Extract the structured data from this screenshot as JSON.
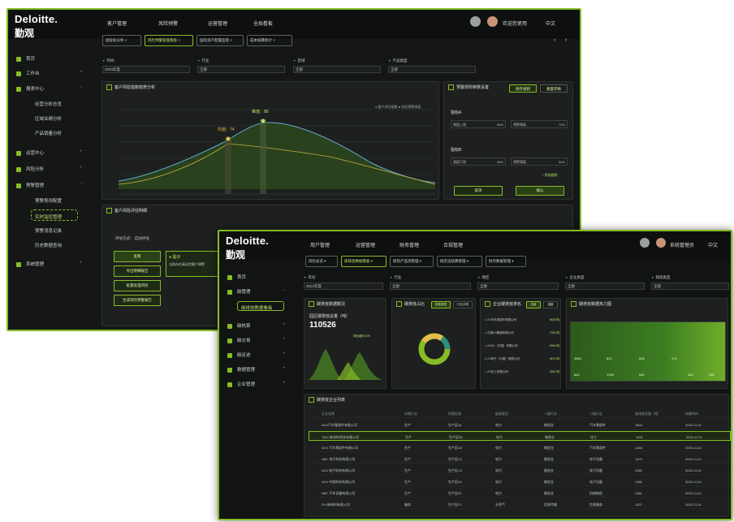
{
  "brand": {
    "name": "Deloitte.",
    "sub": "勤观"
  },
  "colors": {
    "accent": "#86bc25",
    "bg": "#141716"
  },
  "w1": {
    "nav": [
      "客户管理",
      "风险预警",
      "运营管理",
      "全局看板"
    ],
    "user": "欢迎您使用",
    "lang": "中文",
    "tabs": [
      "招投标分析 ×",
      "风险预警管理看板 ×",
      "国有资产配置监管 ×",
      "成本核算统计 ×"
    ],
    "side": [
      {
        "label": "首页",
        "icon": "home-icon"
      },
      {
        "label": "工作台",
        "icon": "grid-icon"
      },
      {
        "label": "报表中心",
        "icon": "report-icon"
      },
      {
        "label": "经营分析总览",
        "icon": ""
      },
      {
        "label": "区域业绩分析",
        "icon": ""
      },
      {
        "label": "产品销量分析",
        "icon": ""
      },
      {
        "label": "运营中心",
        "icon": "ops-icon"
      },
      {
        "label": "风险分析",
        "icon": "risk-icon"
      },
      {
        "label": "预警管理",
        "icon": "alert-icon"
      },
      {
        "label": "预警规则配置",
        "icon": ""
      },
      {
        "label": "实时监控管理",
        "icon": ""
      },
      {
        "label": "预警消息记录",
        "icon": ""
      },
      {
        "label": "历史数据查询",
        "icon": ""
      },
      {
        "label": "系统管理",
        "icon": "settings-icon"
      }
    ],
    "filters": [
      {
        "label": "时间",
        "value": "2023年度"
      },
      {
        "label": "行业",
        "value": "全部"
      },
      {
        "label": "区域",
        "value": "全部"
      },
      {
        "label": "产品类型",
        "value": "全部"
      }
    ],
    "chart_panel": {
      "title": "客户风险指数趋势分析",
      "legend": [
        "客户风险指数",
        "风险预警阈值"
      ],
      "peak1": "峰值：86",
      "peak2": "均值：74"
    },
    "side_panel": {
      "title": "预警规则参数设置",
      "btn1": "保存规则",
      "btn2": "重置参数",
      "sec1": "指标A",
      "sec2": "指标B",
      "in1": "阈值上限",
      "in1u": "85%",
      "in2": "预警阈值",
      "in2u": "70%",
      "in3": "阈值下限",
      "in3u": "35%",
      "in4": "预警阈值",
      "in4u": "50%",
      "add": "+ 添加规则",
      "cancel": "取消",
      "confirm": "确认"
    },
    "bottom_panel": {
      "title": "客户风险评估明细",
      "label": "评估方式：",
      "value": "自动评估",
      "b1": "查看",
      "b2": "导出明细报告",
      "b3": "批量处理风险",
      "b4": "生成风险预警报告",
      "alert": "● 提示",
      "alert_text": "当前存在高风险客户预警"
    }
  },
  "w2": {
    "nav": [
      "用户管理",
      "运营管理",
      "财务管理",
      "合规管理"
    ],
    "user": "系统管理员",
    "lang": "中文",
    "tabs": [
      "风险总览 ▾",
      "碳排放数据看板 ▾",
      "碳资产监测管理 ▾",
      "碳足迹核算管理 ▾",
      "财务数据管理 ▾"
    ],
    "side": [
      {
        "label": "首页",
        "icon": "home-icon"
      },
      {
        "label": "碳管理",
        "icon": "grid-icon"
      },
      {
        "label": "碳排放数据看板",
        "icon": ""
      },
      {
        "label": "碳核算",
        "icon": "calc-icon"
      },
      {
        "label": "碳交易",
        "icon": "trade-icon"
      },
      {
        "label": "碳足迹",
        "icon": "foot-icon"
      },
      {
        "label": "数据管理",
        "icon": "data-icon"
      },
      {
        "label": "企业管理",
        "icon": "company-icon"
      }
    ],
    "filters": [
      {
        "label": "年份",
        "value": "2023年度"
      },
      {
        "label": "行业",
        "value": "全部"
      },
      {
        "label": "地区",
        "value": "全部"
      },
      {
        "label": "企业类型",
        "value": "全部"
      },
      {
        "label": "排放类型",
        "value": "全部"
      }
    ],
    "kpi": {
      "title": "碳排放数据概况",
      "sub": "园区碳排放总量（吨）",
      "value": "110526",
      "peak_note": "同比增长12%"
    },
    "donut": {
      "title": "碳排放占比",
      "tab1": "排放类型",
      "tab2": "行业分类"
    },
    "ranking": {
      "title": "企业碳排放排名",
      "tab1": "总量",
      "tab2": "强度",
      "items": [
        {
          "name": "XX汽车零部件有限公司",
          "value": "9825 吨"
        },
        {
          "name": "中国XX集团有限公司",
          "value": "7350 吨"
        },
        {
          "name": "XXXX（中国）有限公司",
          "value": "5960 吨"
        },
        {
          "name": "XX电子（中国）有限公司",
          "value": "4870 吨"
        },
        {
          "name": "XX化工有限公司",
          "value": "4352 吨"
        }
      ]
    },
    "heat": {
      "title": "碳排放数据热力图",
      "vals": [
        "3884",
        "822",
        "858",
        "472",
        "882",
        "1256",
        "680",
        "340",
        "388"
      ]
    },
    "table": {
      "title": "碳排放企业列表",
      "cols": [
        "企业名称",
        "所属行业",
        "所属区域",
        "能源类型",
        "一级行业",
        "二级行业",
        "碳排放总量（吨）",
        "核算时间"
      ],
      "rows": [
        [
          "AXX汽车零部件有限公司",
          "生产",
          "生产区A1",
          "电力",
          "制造业",
          "汽车零部件",
          "1504",
          "2023.11.24"
        ],
        [
          "BXX 新材料科技有限公司",
          "生产",
          "生产区B2",
          "电力",
          "制造业",
          "化工",
          "1502",
          "2023.11.24"
        ],
        [
          "AXX 汽车零部件有限公司",
          "生产",
          "生产区A3",
          "电力",
          "制造业",
          "汽车零部件",
          "1466",
          "2023.11.24"
        ],
        [
          "ABC 电子科技有限公司",
          "生产",
          "生产区C1",
          "电力",
          "制造业",
          "电子设备",
          "1470",
          "2023.11.24"
        ],
        [
          "AXX 电子科技有限公司",
          "生产",
          "生产区C2",
          "电力",
          "制造业",
          "电子设备",
          "1350",
          "2023.11.24"
        ],
        [
          "AXX 中国科技有限公司",
          "生产",
          "生产区D1",
          "电力",
          "制造业",
          "电子设备",
          "1350",
          "2023.11.24"
        ],
        [
          "ABC 汽车设备有限公司",
          "生产",
          "生产区E1",
          "电力",
          "制造业",
          "机械制造",
          "1361",
          "2023.11.24"
        ],
        [
          "DH 新材料有限公司",
          "服务",
          "生产区F1",
          "天然气",
          "信息传输",
          "信息服务",
          "1327",
          "2023.11.24"
        ]
      ]
    }
  }
}
